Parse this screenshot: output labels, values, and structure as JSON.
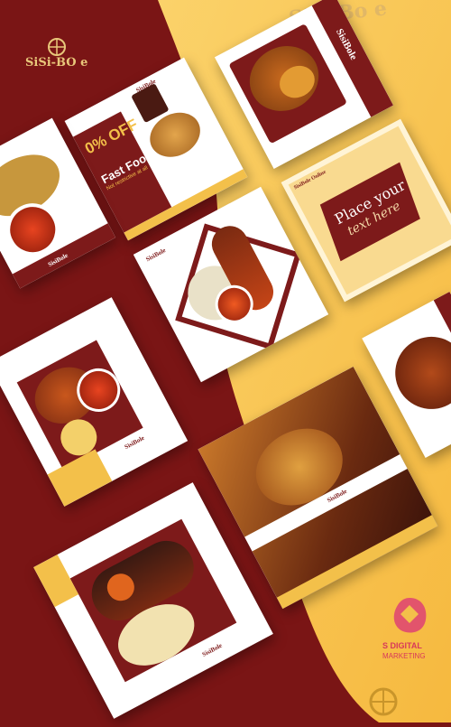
{
  "brand": {
    "name": "Sisi-Bole",
    "top_logo": "Sisi-Bo e",
    "left_logo": "SiSi-BO e",
    "card_tag": "SisiBole"
  },
  "promo_card": {
    "percent": "0% OFF",
    "title": "Fast Food",
    "subtitle": "Not restrictive at all",
    "header": "SisiBole"
  },
  "text_card": {
    "header": "SisiBole Online",
    "line1": "Place your",
    "line2": "text here"
  },
  "agency": {
    "name": "S DIGITAL",
    "sub": "MARKETING"
  },
  "colors": {
    "maroon": "#7d1a1a",
    "gold": "#f3c04a",
    "cream": "#fff4d6"
  }
}
